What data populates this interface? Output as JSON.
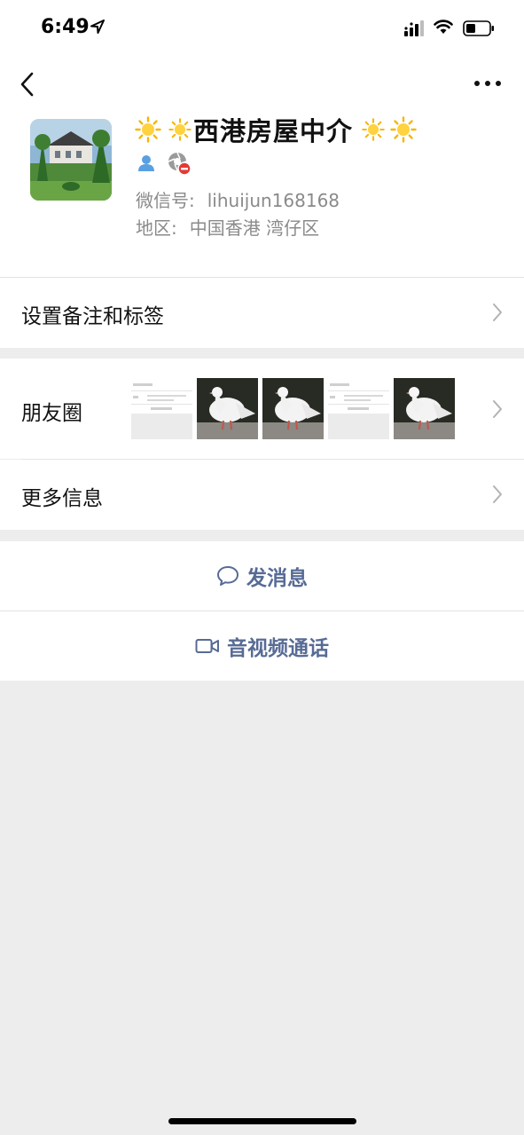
{
  "status_bar": {
    "time": "6:49",
    "icons": [
      "location-arrow-icon",
      "cellular-signal-icon",
      "wifi-icon",
      "battery-icon"
    ]
  },
  "nav": {
    "back_icon": "chevron-left-icon",
    "more_icon": "ellipsis-icon"
  },
  "profile": {
    "name": "西港房屋中介",
    "name_decorations": [
      "sun-emoji",
      "sun-emoji",
      "sun-emoji",
      "sun-emoji"
    ],
    "badges": [
      "contact-person-icon",
      "blocked-moments-icon"
    ],
    "wechat_id_label": "微信号:",
    "wechat_id": "lihuijun168168",
    "region_label": "地区:",
    "region": "中国香港 湾仔区"
  },
  "menu": {
    "remark_tags": "设置备注和标签",
    "moments": "朋友圈",
    "more_info": "更多信息"
  },
  "moments_thumbnails": [
    "text-screenshot",
    "white-pigeon",
    "white-pigeon",
    "text-screenshot",
    "white-pigeon"
  ],
  "actions": {
    "message": "发消息",
    "video_call": "音视频通话"
  },
  "colors": {
    "link_blue": "#576b95",
    "background_gray": "#ededed",
    "secondary_text": "#8a8a8a"
  }
}
